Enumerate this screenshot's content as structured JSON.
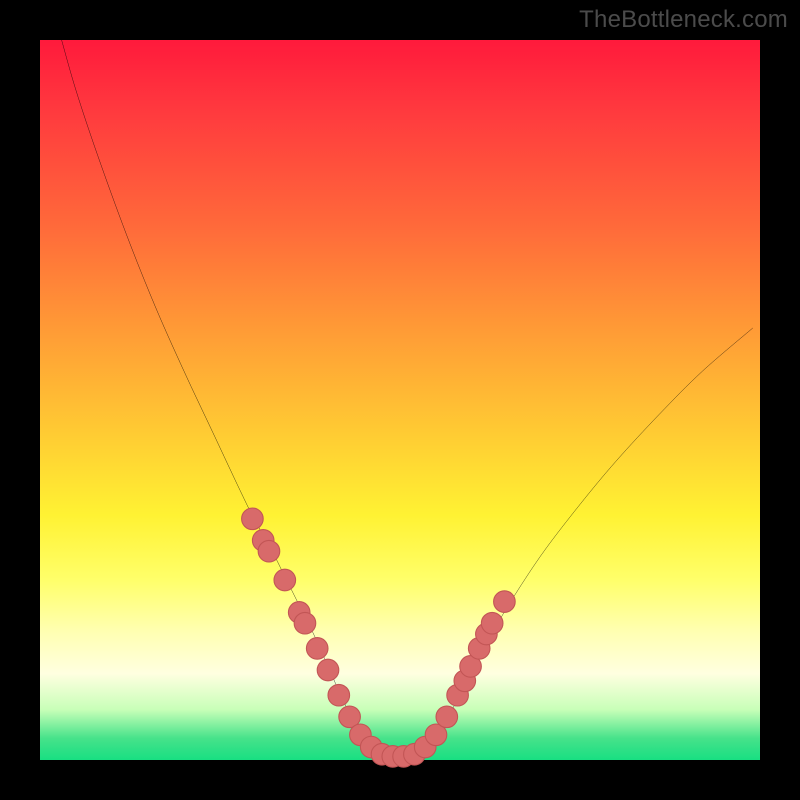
{
  "watermark": "TheBottleneck.com",
  "colors": {
    "frame": "#000000",
    "curve": "#000000",
    "marker_fill": "#d86a6a",
    "marker_stroke": "#c25555",
    "gradient_top": "#ff1a3c",
    "gradient_bottom": "#18df82"
  },
  "chart_data": {
    "type": "line",
    "title": "",
    "xlabel": "",
    "ylabel": "",
    "xlim": [
      0,
      100
    ],
    "ylim": [
      0,
      100
    ],
    "grid": false,
    "legend": false,
    "series": [
      {
        "name": "curve",
        "x": [
          3,
          5,
          8,
          12,
          16,
          20,
          24,
          28,
          30,
          32,
          34,
          36,
          38,
          40,
          42,
          43.5,
          45,
          47,
          49,
          51,
          53,
          55,
          56.5,
          58,
          60,
          63,
          66,
          70,
          75,
          80,
          86,
          92,
          99
        ],
        "y": [
          100,
          93,
          84,
          73,
          63,
          54,
          45.5,
          37,
          33,
          29.5,
          25.5,
          21.5,
          17.5,
          13,
          8.5,
          5.5,
          3,
          1.2,
          0.5,
          0.5,
          1.2,
          3,
          5.5,
          8.5,
          12.5,
          18,
          23,
          29,
          35.5,
          41.5,
          48,
          54,
          60
        ]
      }
    ],
    "markers": {
      "name": "highlighted-points",
      "x": [
        29.5,
        31,
        31.8,
        34,
        36,
        36.8,
        38.5,
        40,
        41.5,
        43,
        44.5,
        46,
        47.5,
        49,
        50.5,
        52,
        53.5,
        55,
        56.5,
        58,
        59,
        59.8,
        61,
        62,
        62.8,
        64.5
      ],
      "y": [
        33.5,
        30.5,
        29,
        25,
        20.5,
        19,
        15.5,
        12.5,
        9,
        6,
        3.5,
        1.8,
        0.8,
        0.5,
        0.5,
        0.8,
        1.8,
        3.5,
        6,
        9,
        11,
        13,
        15.5,
        17.5,
        19,
        22
      ],
      "radius": 1.5
    }
  }
}
